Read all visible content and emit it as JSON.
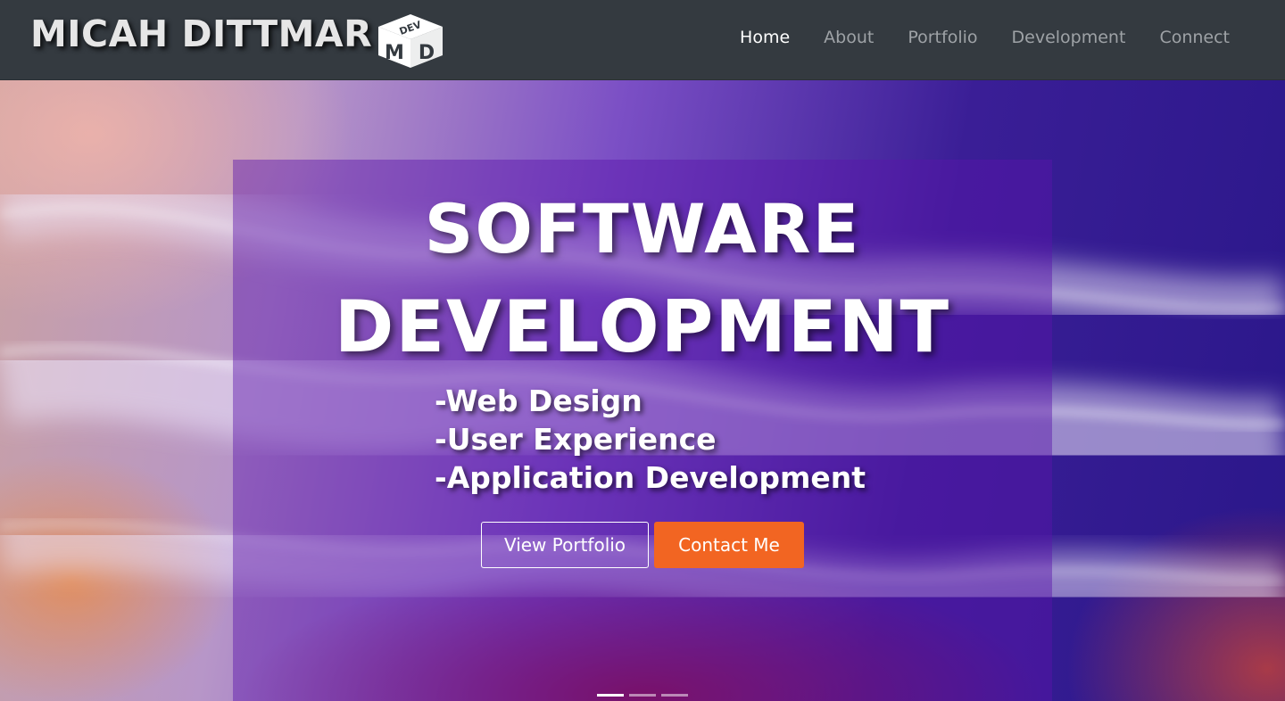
{
  "brand": {
    "name": "MICAH DITTMAR",
    "logo_text": "MD",
    "logo_top_text": "DEV"
  },
  "nav": {
    "items": [
      {
        "label": "Home",
        "active": true
      },
      {
        "label": "About",
        "active": false
      },
      {
        "label": "Portfolio",
        "active": false
      },
      {
        "label": "Development",
        "active": false
      },
      {
        "label": "Connect",
        "active": false
      }
    ]
  },
  "hero": {
    "headline_line1": "SOFTWARE",
    "headline_line2": "DEVELOPMENT",
    "services": [
      "-Web Design",
      "-User Experience",
      "-Application Development"
    ],
    "buttons": {
      "portfolio_label": "View Portfolio",
      "contact_label": "Contact Me"
    },
    "carousel": {
      "slides": 3,
      "active_index": 0
    }
  },
  "colors": {
    "navbar_bg": "#343a40",
    "accent": "#f26522",
    "nav_active": "#ffffff",
    "nav_inactive": "#9ea2a6"
  }
}
